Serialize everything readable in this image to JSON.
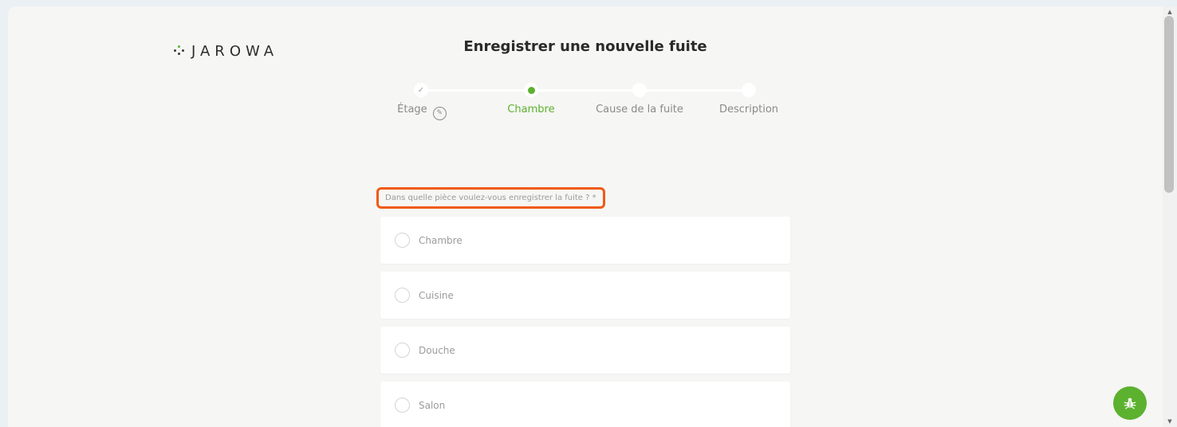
{
  "brand": {
    "name": "JAROWA"
  },
  "header": {
    "title": "Enregistrer une nouvelle fuite"
  },
  "stepper": {
    "steps": [
      {
        "label": "Étage",
        "state": "done"
      },
      {
        "label": "Chambre",
        "state": "active"
      },
      {
        "label": "Cause de la fuite",
        "state": "upcoming"
      },
      {
        "label": "Description",
        "state": "upcoming"
      }
    ]
  },
  "form": {
    "question": "Dans quelle pièce voulez-vous enregistrer la fuite ? *",
    "options": [
      {
        "label": "Chambre"
      },
      {
        "label": "Cuisine"
      },
      {
        "label": "Douche"
      },
      {
        "label": "Salon"
      }
    ]
  },
  "icons": {
    "check": "check-icon",
    "edit": "pencil-icon",
    "bug": "bug-icon"
  },
  "colors": {
    "accent": "#5cb12f",
    "highlight": "#f05a14",
    "muted_text": "#9b9b9b"
  }
}
